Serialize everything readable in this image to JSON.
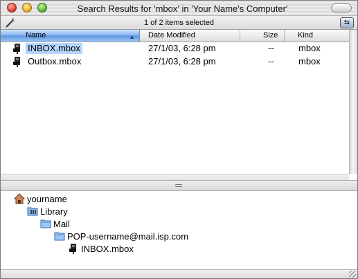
{
  "window": {
    "title": "Search Results for 'mbox' in 'Your Name's Computer'"
  },
  "status": {
    "text": "1 of 2 items selected"
  },
  "columns": {
    "name": "Name",
    "date": "Date Modified",
    "size": "Size",
    "kind": "Kind"
  },
  "files": [
    {
      "name": "INBOX.mbox",
      "date": "27/1/03, 6:28 pm",
      "size": "--",
      "kind": "mbox",
      "selected": true
    },
    {
      "name": "Outbox.mbox",
      "date": "27/1/03, 6:28 pm",
      "size": "--",
      "kind": "mbox",
      "selected": false
    }
  ],
  "path": [
    {
      "label": "yourname",
      "icon": "home-icon"
    },
    {
      "label": "Library",
      "icon": "library-folder-icon"
    },
    {
      "label": "Mail",
      "icon": "folder-icon"
    },
    {
      "label": "POP-username@mail.isp.com",
      "icon": "folder-icon"
    },
    {
      "label": "INBOX.mbox",
      "icon": "mailbox-file-icon"
    }
  ],
  "colors": {
    "selection": "#b5d5ff",
    "sorted_column": "#7fb0ee"
  }
}
